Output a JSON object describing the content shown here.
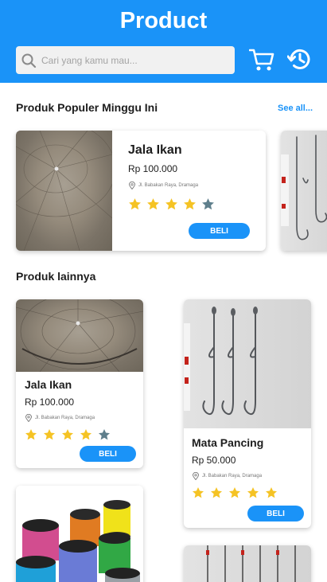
{
  "header": {
    "title": "Product",
    "search_placeholder": "Cari yang kamu mau...",
    "icons": [
      "search-icon",
      "cart-icon",
      "history-icon"
    ]
  },
  "popular": {
    "title": "Produk Populer Minggu Ini",
    "see_all": "See all...",
    "items": [
      {
        "name": "Jala Ikan",
        "price": "Rp 100.000",
        "location": "Jl. Babakan Raya, Dramaga",
        "rating": 4,
        "buy": "BELI"
      }
    ]
  },
  "others": {
    "title": "Produk lainnya",
    "items": [
      {
        "name": "Jala Ikan",
        "price": "Rp 100.000",
        "location": "Jl. Babakan Raya, Dramaga",
        "rating": 4,
        "buy": "BELI"
      },
      {
        "name": "Mata Pancing",
        "price": "Rp 50.000",
        "location": "Jl. Babakan Raya, Dramaga",
        "rating": 5,
        "buy": "BELI"
      }
    ]
  },
  "colors": {
    "primary": "#1a93f8",
    "star_filled": "#f5c324",
    "star_empty": "#5f7f8c"
  }
}
